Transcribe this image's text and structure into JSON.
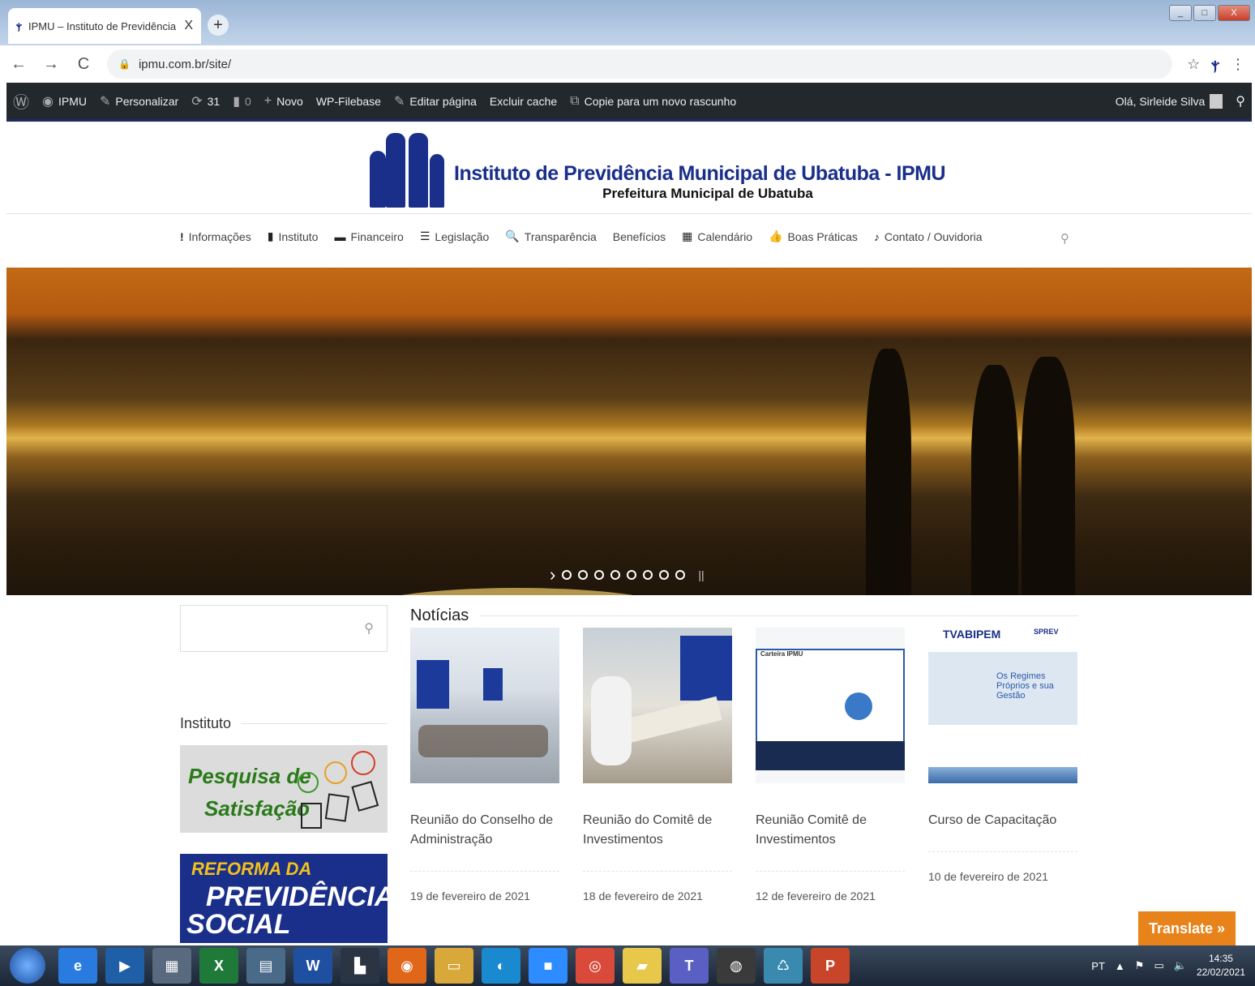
{
  "browser": {
    "tab_title": "IPMU – Instituto de Previdência M",
    "tab_close": "X",
    "new_tab": "+",
    "url": "ipmu.com.br/site/",
    "back": "←",
    "forward": "→",
    "reload": "C",
    "lock": "🔒",
    "star": "☆",
    "menu": "⋮",
    "win_min": "_",
    "win_max": "□",
    "win_close": "X"
  },
  "wpbar": {
    "wp_icon": "Ⓦ",
    "site_name": "IPMU",
    "customize": "Personalizar",
    "updates": "31",
    "comments": "0",
    "new": "Novo",
    "filebase": "WP-Filebase",
    "edit_page": "Editar página",
    "clear_cache": "Excluir cache",
    "copy_draft": "Copie para um novo rascunho",
    "greeting": "Olá, Sirleide Silva"
  },
  "header": {
    "title": "Instituto de Previdência Municipal de Ubatuba - IPMU",
    "subtitle": "Prefeitura Municipal de Ubatuba"
  },
  "nav": {
    "items": [
      {
        "icon": "!",
        "label": "Informações"
      },
      {
        "icon": "▮",
        "label": "Instituto"
      },
      {
        "icon": "▬",
        "label": "Financeiro"
      },
      {
        "icon": "☰",
        "label": "Legislação"
      },
      {
        "icon": "🔍",
        "label": "Transparência"
      },
      {
        "icon": "",
        "label": "Benefícios"
      },
      {
        "icon": "▦",
        "label": "Calendário"
      },
      {
        "icon": "👍",
        "label": "Boas Práticas"
      },
      {
        "icon": "♪",
        "label": "Contato / Ouvidoria"
      }
    ]
  },
  "hero": {
    "next": "›",
    "pause": "||",
    "slide_count": 8
  },
  "sidebar": {
    "widget_title": "Instituto",
    "banner1_line1": "Pesquisa de",
    "banner1_line2": "Satisfação",
    "banner2_line1": "REFORMA DA",
    "banner2_line2": "PREVIDÊNCIA",
    "banner2_line3": "SOCIAL"
  },
  "news": {
    "title": "Notícias",
    "cards": [
      {
        "title": "Reunião do Conselho de Administração",
        "date": "19 de fevereiro de 2021"
      },
      {
        "title": "Reunião do Comitê de Investimentos",
        "date": "18 de fevereiro de 2021"
      },
      {
        "title": "Reunião Comitê de Investimentos",
        "date": "12 de fevereiro de 2021"
      },
      {
        "title": "Curso de Capacitação",
        "date": "10 de fevereiro de 2021"
      }
    ],
    "card4_brand1": "TVABIPEM",
    "card4_brand2": "SPREV",
    "card4_heading": "Os Regimes Próprios e sua Gestão",
    "card3_label": "Carteira IPMU"
  },
  "translate": "Translate »",
  "taskbar": {
    "lang": "PT",
    "time": "14:35",
    "date": "22/02/2021",
    "apps": [
      {
        "name": "ie",
        "glyph": "e",
        "color": "#2a7be0"
      },
      {
        "name": "media",
        "glyph": "▶",
        "color": "#1f5fa8"
      },
      {
        "name": "calculator",
        "glyph": "▦",
        "color": "#596a7e"
      },
      {
        "name": "excel",
        "glyph": "X",
        "color": "#1f7a3a"
      },
      {
        "name": "explorer-app",
        "glyph": "▤",
        "color": "#4a6a8a"
      },
      {
        "name": "word",
        "glyph": "W",
        "color": "#1f4fa0"
      },
      {
        "name": "cmd",
        "glyph": "▙",
        "color": "#2a3442"
      },
      {
        "name": "firefox",
        "glyph": "◉",
        "color": "#e0661a"
      },
      {
        "name": "folder",
        "glyph": "▭",
        "color": "#d8a83a"
      },
      {
        "name": "edge",
        "glyph": "◐",
        "color": "#1a8ad0"
      },
      {
        "name": "zoom",
        "glyph": "■",
        "color": "#2d8cff"
      },
      {
        "name": "chrome",
        "glyph": "◎",
        "color": "#d94a3a"
      },
      {
        "name": "stickies",
        "glyph": "▰",
        "color": "#e8c84a"
      },
      {
        "name": "teams",
        "glyph": "T",
        "color": "#5a5fc4"
      },
      {
        "name": "camera",
        "glyph": "◍",
        "color": "#3a3a3a"
      },
      {
        "name": "recycle",
        "glyph": "♺",
        "color": "#3a8ab0"
      },
      {
        "name": "powerpoint",
        "glyph": "P",
        "color": "#c8452a"
      }
    ]
  }
}
